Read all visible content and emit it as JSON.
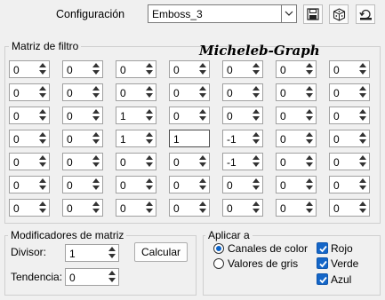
{
  "config": {
    "label": "Configuración",
    "preset_value": "Emboss_3",
    "dropdown_icon": "chevron-down-icon",
    "buttons": [
      {
        "name": "save-preset-button",
        "icon": "floppy-disk-icon"
      },
      {
        "name": "random-button",
        "icon": "dice-icon"
      },
      {
        "name": "reset-button",
        "icon": "reset-icon"
      }
    ]
  },
  "matrix": {
    "title": "Matriz de filtro",
    "watermark": "Micheleb-Graph",
    "rows": [
      [
        "0",
        "0",
        "0",
        "0",
        "0",
        "0",
        "0"
      ],
      [
        "0",
        "0",
        "0",
        "0",
        "0",
        "0",
        "0"
      ],
      [
        "0",
        "0",
        "1",
        "0",
        "0",
        "0",
        "0"
      ],
      [
        "0",
        "0",
        "1",
        "1",
        "-1",
        "0",
        "0"
      ],
      [
        "0",
        "0",
        "0",
        "0",
        "-1",
        "0",
        "0"
      ],
      [
        "0",
        "0",
        "0",
        "0",
        "0",
        "0",
        "0"
      ],
      [
        "0",
        "0",
        "0",
        "0",
        "0",
        "0",
        "0"
      ]
    ]
  },
  "modifiers": {
    "title": "Modificadores de matriz",
    "divisor_label": "Divisor:",
    "divisor_value": "1",
    "bias_label": "Tendencia:",
    "bias_value": "0",
    "calc_label": "Calcular"
  },
  "apply": {
    "title": "Aplicar a",
    "radio_color": "Canales de color",
    "radio_gray": "Valores de gris",
    "selected": "Canales de color",
    "check_red": "Rojo",
    "check_green": "Verde",
    "check_blue": "Azul",
    "checked": [
      "Rojo",
      "Verde",
      "Azul"
    ]
  },
  "colors": {
    "background": "#f0f0f0",
    "accent": "#1466c8"
  }
}
